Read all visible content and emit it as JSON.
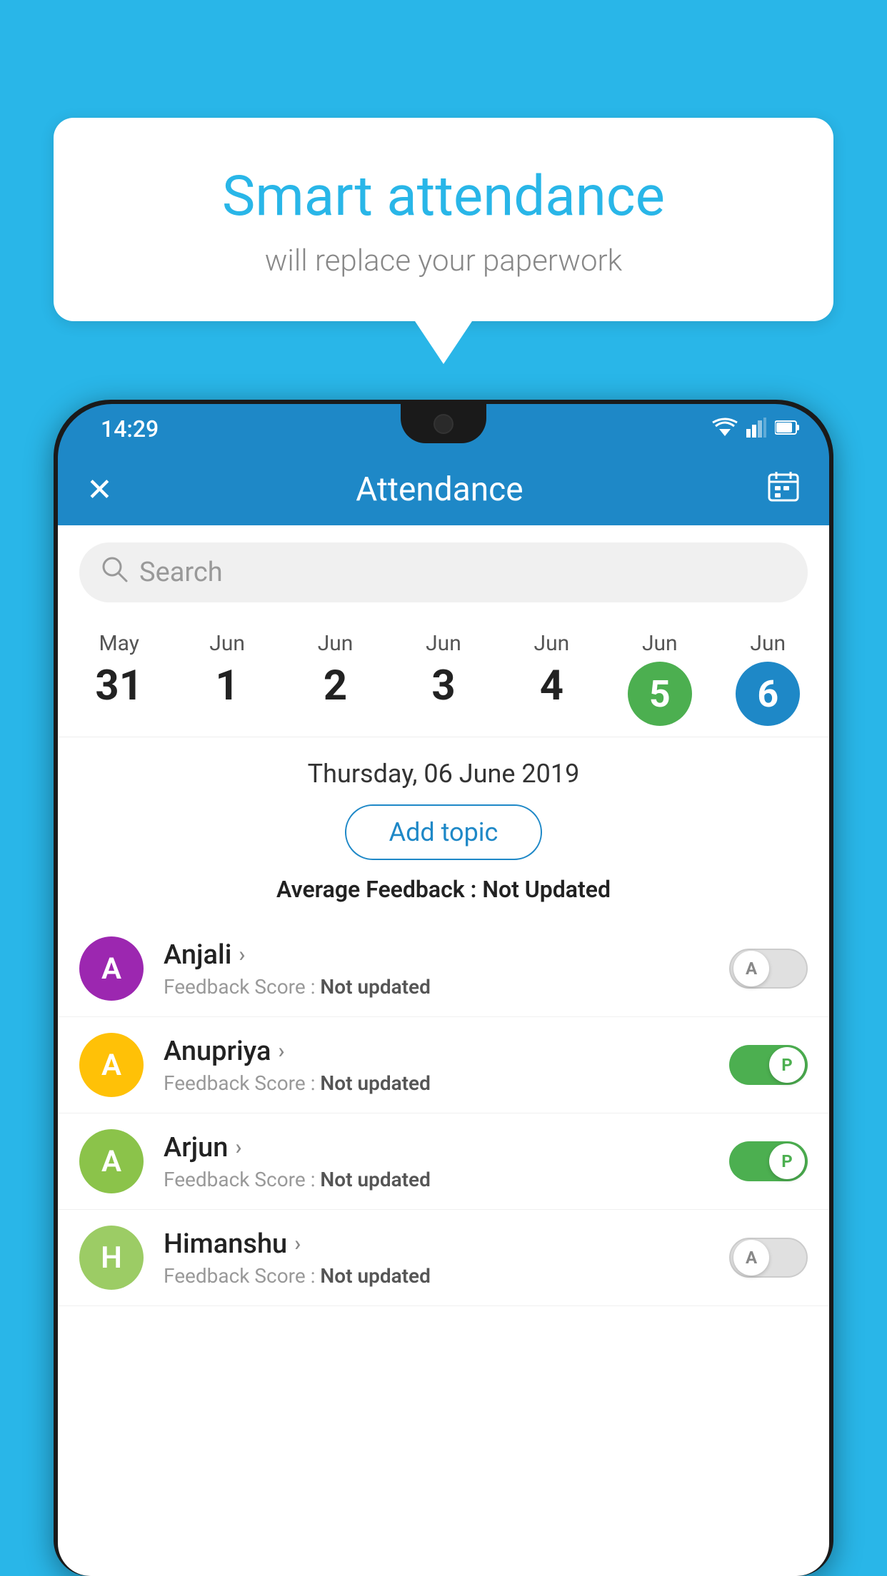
{
  "background_color": "#29B6E8",
  "bubble": {
    "title": "Smart attendance",
    "subtitle": "will replace your paperwork"
  },
  "status_bar": {
    "time": "14:29",
    "wifi_icon": "▼",
    "signal_icon": "◄",
    "battery_icon": "▮"
  },
  "header": {
    "title": "Attendance",
    "close_label": "✕",
    "calendar_icon": "📅"
  },
  "search": {
    "placeholder": "Search"
  },
  "calendar": {
    "days": [
      {
        "month": "May",
        "date": "31",
        "state": "normal"
      },
      {
        "month": "Jun",
        "date": "1",
        "state": "normal"
      },
      {
        "month": "Jun",
        "date": "2",
        "state": "normal"
      },
      {
        "month": "Jun",
        "date": "3",
        "state": "normal"
      },
      {
        "month": "Jun",
        "date": "4",
        "state": "normal"
      },
      {
        "month": "Jun",
        "date": "5",
        "state": "today"
      },
      {
        "month": "Jun",
        "date": "6",
        "state": "selected"
      }
    ]
  },
  "selected_date": "Thursday, 06 June 2019",
  "add_topic_label": "Add topic",
  "avg_feedback_label": "Average Feedback : ",
  "avg_feedback_value": "Not Updated",
  "students": [
    {
      "name": "Anjali",
      "avatar_letter": "A",
      "avatar_color": "purple",
      "feedback_label": "Feedback Score : ",
      "feedback_value": "Not updated",
      "toggle": "off",
      "toggle_label": "A"
    },
    {
      "name": "Anupriya",
      "avatar_letter": "A",
      "avatar_color": "orange",
      "feedback_label": "Feedback Score : ",
      "feedback_value": "Not updated",
      "toggle": "on",
      "toggle_label": "P"
    },
    {
      "name": "Arjun",
      "avatar_letter": "A",
      "avatar_color": "green-light",
      "feedback_label": "Feedback Score : ",
      "feedback_value": "Not updated",
      "toggle": "on",
      "toggle_label": "P"
    },
    {
      "name": "Himanshu",
      "avatar_letter": "H",
      "avatar_color": "olive",
      "feedback_label": "Feedback Score : ",
      "feedback_value": "Not updated",
      "toggle": "off",
      "toggle_label": "A"
    }
  ]
}
